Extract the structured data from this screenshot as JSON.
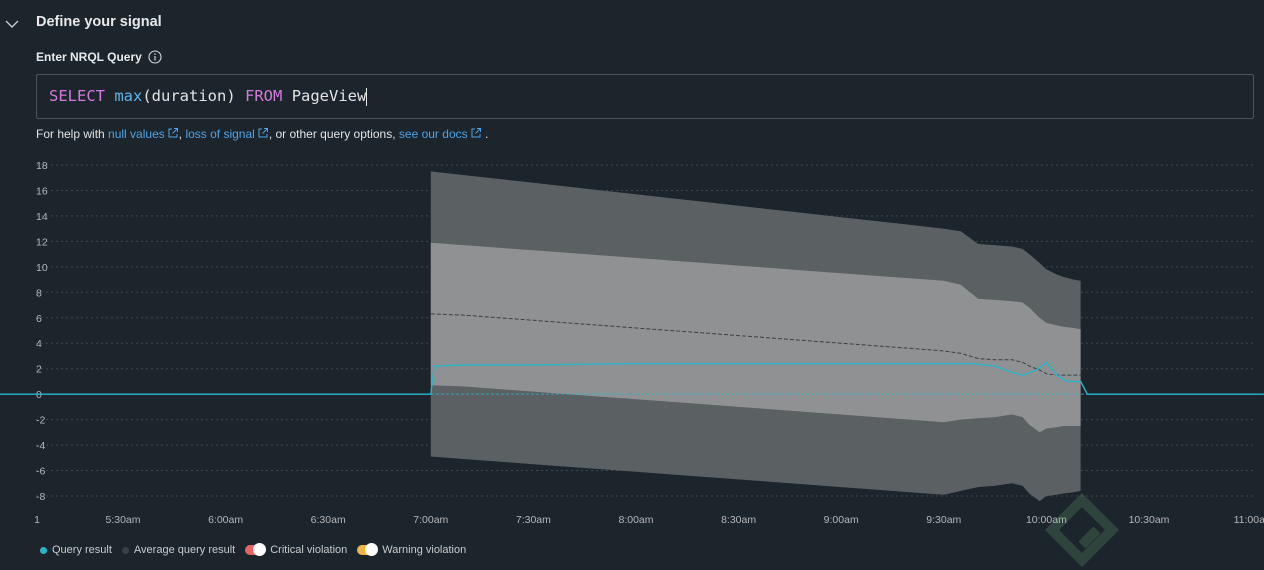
{
  "section": {
    "title": "Define your signal"
  },
  "query": {
    "label": "Enter NRQL Query",
    "tokens": {
      "select": "SELECT",
      "func": "max",
      "arg": "(duration)",
      "from": "FROM",
      "table": "PageView"
    }
  },
  "help": {
    "prefix": "For help with",
    "link1": "null values",
    "sep1": ",",
    "link2": "loss of signal",
    "mid": ", or other query options,",
    "link3": "see our docs",
    "end": "."
  },
  "legend": {
    "query_result": "Query result",
    "average_query_result": "Average query result",
    "critical_violation": "Critical violation",
    "warning_violation": "Warning violation"
  },
  "colors": {
    "query_result": "#2bb5c9",
    "average_dot": "#3a4146",
    "critical": "#e86262",
    "warning": "#f0b63f",
    "link": "#4fa3e8"
  },
  "chart_data": {
    "type": "area",
    "y_ticks": [
      "18",
      "16",
      "14",
      "12",
      "10",
      "8",
      "6",
      "4",
      "2",
      "0",
      "-2",
      "-4",
      "-6",
      "-8"
    ],
    "x_ticks": [
      "1",
      "5:30am",
      "6:00am",
      "6:30am",
      "7:00am",
      "7:30am",
      "8:00am",
      "8:30am",
      "9:00am",
      "9:30am",
      "10:00am",
      "10:30am",
      "11:00a"
    ],
    "ylim": [
      -8,
      18
    ],
    "grid": true,
    "x_minutes": [
      420,
      430,
      440,
      450,
      460,
      470,
      480,
      490,
      500,
      510,
      520,
      530,
      540,
      550,
      560,
      570,
      575,
      580,
      585,
      590,
      593,
      595,
      598,
      600,
      603,
      605,
      608,
      610
    ],
    "outer_upper": [
      17.5,
      17.2,
      16.9,
      16.6,
      16.3,
      16.0,
      15.7,
      15.4,
      15.1,
      14.8,
      14.5,
      14.2,
      13.9,
      13.6,
      13.3,
      13.0,
      12.8,
      11.8,
      11.7,
      11.6,
      11.4,
      11.0,
      10.3,
      9.8,
      9.4,
      9.2,
      9.0,
      8.9
    ],
    "inner_upper": [
      11.9,
      11.7,
      11.5,
      11.3,
      11.1,
      10.9,
      10.7,
      10.5,
      10.3,
      10.1,
      9.9,
      9.7,
      9.5,
      9.3,
      9.1,
      8.9,
      8.6,
      7.5,
      7.4,
      7.3,
      7.2,
      6.8,
      6.0,
      5.6,
      5.4,
      5.3,
      5.2,
      5.1
    ],
    "inner_lower": [
      0.7,
      0.6,
      0.4,
      0.2,
      0.0,
      -0.2,
      -0.4,
      -0.6,
      -0.8,
      -1.0,
      -1.2,
      -1.4,
      -1.6,
      -1.8,
      -2.0,
      -2.2,
      -2.0,
      -1.9,
      -1.8,
      -1.6,
      -1.8,
      -2.4,
      -3.0,
      -2.7,
      -2.6,
      -2.5,
      -2.5,
      -2.5
    ],
    "outer_lower": [
      -4.9,
      -5.1,
      -5.3,
      -5.5,
      -5.7,
      -5.9,
      -6.1,
      -6.3,
      -6.5,
      -6.7,
      -6.9,
      -7.1,
      -7.3,
      -7.5,
      -7.7,
      -7.9,
      -7.6,
      -7.3,
      -7.2,
      -7.0,
      -7.2,
      -7.8,
      -8.4,
      -8.0,
      -7.9,
      -7.8,
      -7.7,
      -7.6
    ],
    "average": [
      6.3,
      6.2,
      6.0,
      5.8,
      5.6,
      5.4,
      5.2,
      5.0,
      4.8,
      4.6,
      4.4,
      4.2,
      4.0,
      3.8,
      3.6,
      3.4,
      3.2,
      2.8,
      2.7,
      2.7,
      2.5,
      2.2,
      1.9,
      1.6,
      1.5,
      1.5,
      1.5,
      1.5
    ],
    "query_result_x": [
      270,
      420,
      421,
      430,
      450,
      480,
      510,
      540,
      560,
      570,
      578,
      585,
      590,
      593,
      597,
      600,
      603,
      606,
      610,
      612,
      705
    ],
    "query_result_y": [
      0,
      0,
      2.2,
      2.3,
      2.3,
      2.4,
      2.4,
      2.4,
      2.4,
      2.4,
      2.4,
      2.2,
      1.7,
      1.5,
      1.9,
      2.5,
      1.5,
      1.0,
      1.0,
      0,
      0
    ]
  }
}
